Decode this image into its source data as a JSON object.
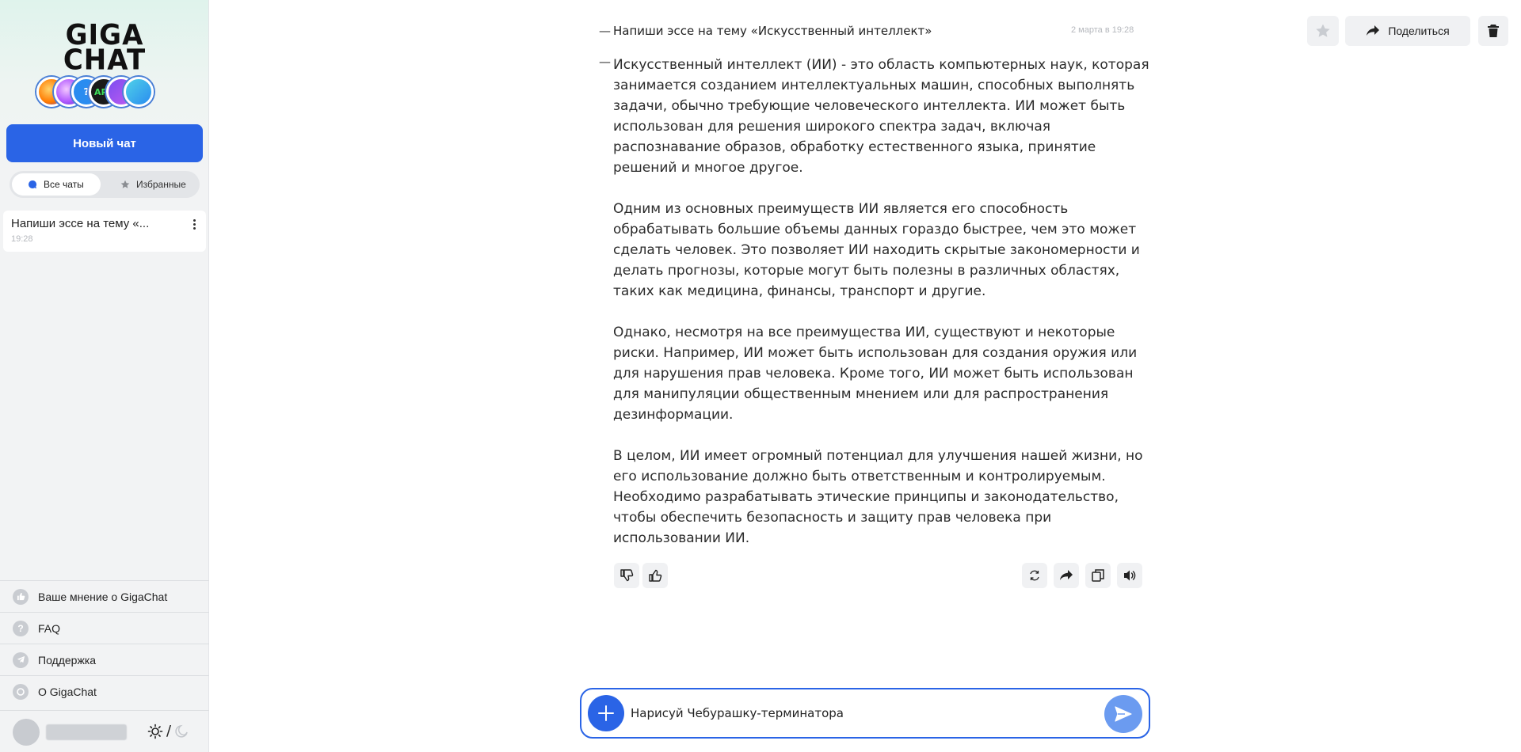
{
  "sidebar": {
    "logo_line1": "GIGA",
    "logo_line2": "CHAT",
    "avatar_label": "APE",
    "new_chat_label": "Новый чат",
    "tabs": {
      "all_label": "Все чаты",
      "favorites_label": "Избранные"
    },
    "chats": [
      {
        "title": "Напиши эссе на тему «...",
        "time": "19:28"
      }
    ],
    "menu": [
      {
        "label": "Ваше мнение о GigaChat",
        "icon": "like-icon"
      },
      {
        "label": "FAQ",
        "icon": "question-icon"
      },
      {
        "label": "Поддержка",
        "icon": "telegram-icon"
      },
      {
        "label": "О GigaChat",
        "icon": "gigachat-icon"
      }
    ],
    "theme_separator": "/"
  },
  "header": {
    "share_label": "Поделиться"
  },
  "conversation": {
    "question": {
      "text": "Напиши эссе на тему «Искусственный интеллект»",
      "time": "2 марта в 19:28"
    },
    "answer_paragraphs": [
      "Искусственный интеллект (ИИ) - это область компьютерных наук, которая занимается созданием интеллектуальных машин, способных выполнять задачи, обычно требующие человеческого интеллекта. ИИ может быть использован для решения широкого спектра задач, включая распознавание образов, обработку естественного языка, принятие решений и многое другое.",
      "Одним из основных преимуществ ИИ является его способность обрабатывать большие объемы данных гораздо быстрее, чем это может сделать человек. Это позволяет ИИ находить скрытые закономерности и делать прогнозы, которые могут быть полезны в различных областях, таких как медицина, финансы, транспорт и другие.",
      "Однако, несмотря на все преимущества ИИ, существуют и некоторые риски. Например, ИИ может быть использован для создания оружия или для нарушения прав человека. Кроме того, ИИ может быть использован для манипуляции общественным мнением или для распространения дезинформации.",
      "В целом, ИИ имеет огромный потенциал для улучшения нашей жизни, но его использование должно быть ответственным и контролируемым. Необходимо разрабатывать этические принципы и законодательство, чтобы обеспечить безопасность и защиту прав человека при использовании ИИ."
    ]
  },
  "composer": {
    "value": "Нарисуй Чебурашку-терминатора"
  },
  "colors": {
    "accent": "#2a64e6",
    "send_button": "#6b9bf0",
    "sidebar_bg": "#f2f3f4"
  }
}
